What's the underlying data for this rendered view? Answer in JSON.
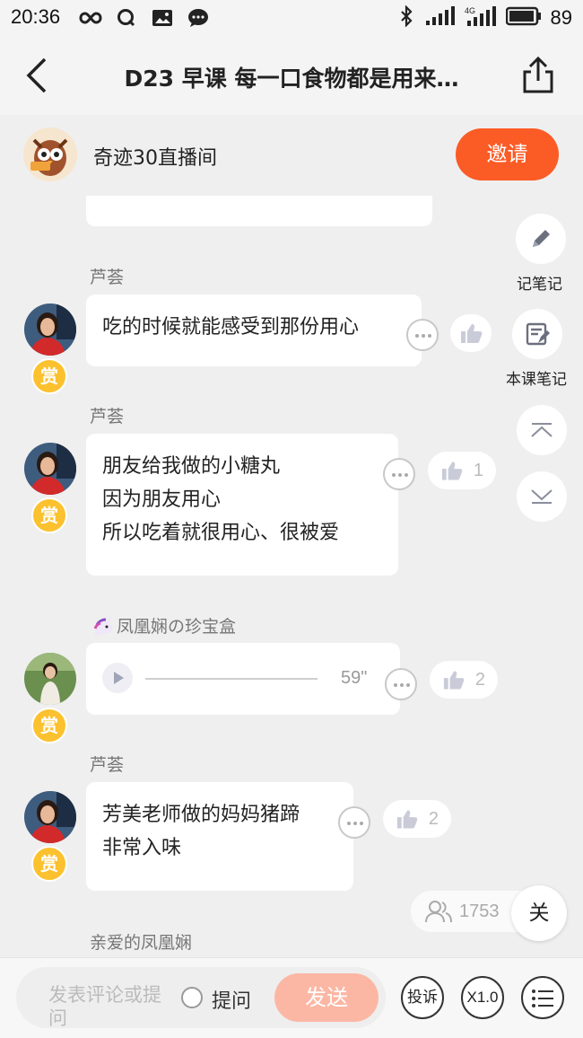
{
  "status_bar": {
    "time": "20:36",
    "battery": "89",
    "network": "4G"
  },
  "header": {
    "title": "D23 早课 每一口食物都是用来…"
  },
  "room": {
    "name": "奇迹30直播间",
    "invite_label": "邀请"
  },
  "tools": {
    "note_label": "记笔记",
    "course_note_label": "本课笔记"
  },
  "messages": [
    {
      "sender": "芦荟",
      "lines": [
        "吃的时候就能感受到那份用心"
      ],
      "likes": ""
    },
    {
      "sender": "芦荟",
      "lines": [
        "朋友给我做的小糖丸",
        "因为朋友用心",
        "所以吃着就很用心、很被爱"
      ],
      "likes": "1"
    },
    {
      "sender": "凤凰娴の珍宝盒",
      "audio_duration": "59\"",
      "likes": "2"
    },
    {
      "sender": "芦荟",
      "lines": [
        "芳美老师做的妈妈猪蹄",
        "非常入味"
      ],
      "likes": "2"
    },
    {
      "sender": "亲爱的凤凰娴"
    }
  ],
  "reward_label": "赏",
  "online": {
    "count": "1753",
    "close_label": "关"
  },
  "bottom_bar": {
    "input_placeholder": "发表评论或提问",
    "ask_label": "提问",
    "send_label": "发送",
    "report_label": "投诉",
    "speed_label": "X1.0"
  },
  "colors": {
    "accent": "#fb5b25",
    "reward": "#fbc12f",
    "send_disabled": "#fcb7a4"
  }
}
